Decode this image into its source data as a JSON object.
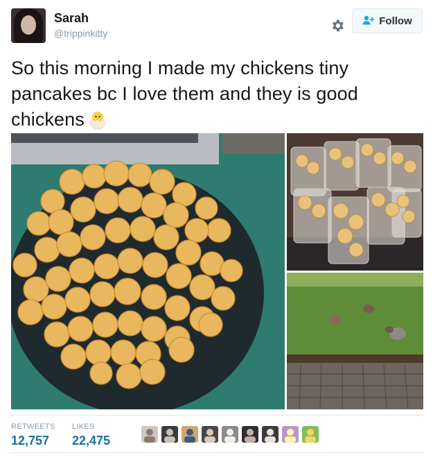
{
  "user": {
    "name": "Sarah",
    "handle": "@trippinkitty"
  },
  "actions": {
    "follow_label": "Follow",
    "settings_icon": "gear-icon",
    "follow_icon": "add-user-icon"
  },
  "tweet": {
    "lines": [
      "So this morning I made my chickens tiny",
      "pancakes bc I love them and they is good",
      "chickens"
    ],
    "emoji": "hatching-chick-icon"
  },
  "media": [
    "plate-of-tiny-pancakes-photo",
    "cups-of-tiny-pancakes-photo",
    "chickens-in-yard-photo"
  ],
  "stats": {
    "retweets_label": "RETWEETS",
    "retweets_value": "12,757",
    "likes_label": "LIKES",
    "likes_value": "22,475"
  },
  "likers": [
    "liker-avatar",
    "liker-avatar",
    "liker-avatar",
    "liker-avatar",
    "liker-avatar",
    "liker-avatar",
    "liker-avatar",
    "liker-avatar",
    "liker-avatar"
  ],
  "colors": {
    "link_blue": "#1b6fa1",
    "muted": "#8899a6",
    "follow_icon": "#1da1f2"
  }
}
